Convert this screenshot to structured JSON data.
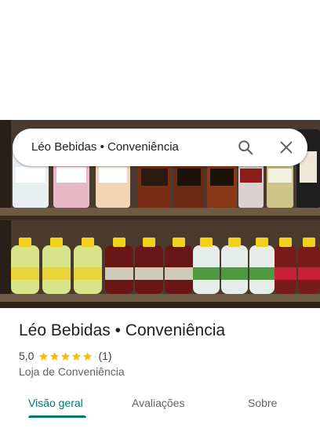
{
  "search": {
    "query": "Léo Bebidas • Conveniência",
    "search_icon": "search-icon",
    "close_icon": "close-icon"
  },
  "place": {
    "title": "Léo Bebidas • Conveniência",
    "rating": "5,0",
    "rating_stars_filled": 5,
    "review_count": "(1)",
    "category": "Loja de Conveniência"
  },
  "tabs": [
    {
      "label": "Visão geral",
      "active": true
    },
    {
      "label": "Avaliações",
      "active": false
    },
    {
      "label": "Sobre",
      "active": false
    }
  ],
  "colors": {
    "accent": "#00796b",
    "star": "#fbbc04",
    "text_primary": "#202124",
    "text_secondary": "#5f6368"
  }
}
